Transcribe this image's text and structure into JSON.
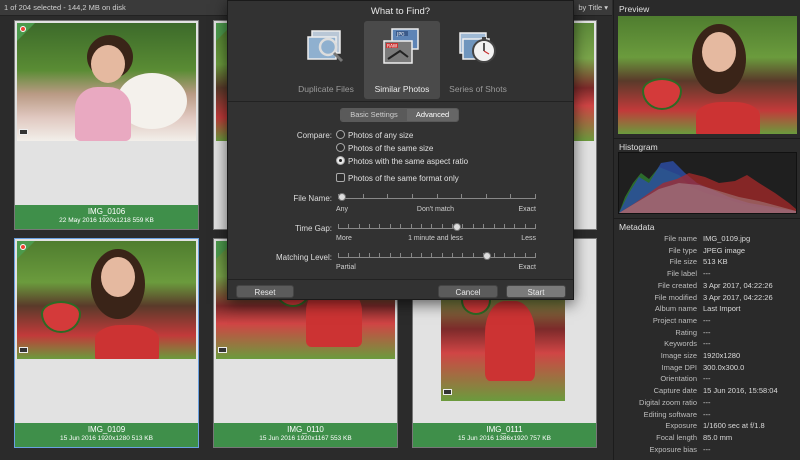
{
  "topbar": {
    "status": "1 of 204 selected - 144,2 MB on disk",
    "sort": "by Title ▾"
  },
  "cards": [
    {
      "name": "IMG_0106",
      "meta": "22 May 2016   1920x1218   559 KB"
    },
    {
      "name": "IMG_0109",
      "meta": "15 Jun 2016   1920x1280   513 KB"
    },
    {
      "name": "IMG_0110",
      "meta": "15 Jun 2016   1920x1167   553 KB"
    },
    {
      "name": "IMG_0111",
      "meta": "15 Jun 2016   1386x1920   757 KB"
    }
  ],
  "dialog": {
    "title": "What to Find?",
    "modes": [
      {
        "label": "Duplicate Files",
        "icon": "magnifier-photos-icon"
      },
      {
        "label": "Similar Photos",
        "icon": "jpg-raw-photos-icon"
      },
      {
        "label": "Series of Shots",
        "icon": "stopwatch-photos-icon"
      }
    ],
    "tabs": [
      "Basic Settings",
      "Advanced"
    ],
    "compare_label": "Compare:",
    "compare_options": [
      "Photos of any size",
      "Photos of the same size",
      "Photos with the same aspect ratio"
    ],
    "compare_selected": "Photos with the same aspect ratio",
    "same_format_label": "Photos of the same format only",
    "same_format_checked": false,
    "file_name": {
      "label": "File Name:",
      "min": "Any",
      "mid": "Don't match",
      "max": "Exact",
      "value": 0.0
    },
    "time_gap": {
      "label": "Time Gap:",
      "min": "More",
      "mid": "1 minute and less",
      "max": "Less",
      "value": 0.6
    },
    "matching": {
      "label": "Matching Level:",
      "min": "Partial",
      "max": "Exact",
      "value": 0.75
    },
    "buttons": {
      "reset": "Reset",
      "cancel": "Cancel",
      "start": "Start"
    }
  },
  "panel": {
    "preview_title": "Preview",
    "histogram_title": "Histogram",
    "metadata_title": "Metadata",
    "metadata": [
      {
        "k": "File name",
        "v": "IMG_0109.jpg"
      },
      {
        "k": "File type",
        "v": "JPEG image"
      },
      {
        "k": "File size",
        "v": "513 KB"
      },
      {
        "k": "File label",
        "v": "---"
      },
      {
        "k": "File created",
        "v": "3 Apr 2017, 04:22:26"
      },
      {
        "k": "File modified",
        "v": "3 Apr 2017, 04:22:26"
      },
      {
        "k": "Album name",
        "v": "Last Import"
      },
      {
        "k": "Project name",
        "v": "---"
      },
      {
        "k": "Rating",
        "v": "---"
      },
      {
        "k": "Keywords",
        "v": "---"
      },
      {
        "k": "Image size",
        "v": "1920x1280"
      },
      {
        "k": "Image DPI",
        "v": "300.0x300.0"
      },
      {
        "k": "Orientation",
        "v": "---"
      },
      {
        "k": "Capture date",
        "v": "15 Jun 2016, 15:58:04"
      },
      {
        "k": "Digital zoom ratio",
        "v": "---"
      },
      {
        "k": "Editing software",
        "v": "---"
      },
      {
        "k": "Exposure",
        "v": "1/1600 sec at f/1.8"
      },
      {
        "k": "Focal length",
        "v": "85.0 mm"
      },
      {
        "k": "Exposure bias",
        "v": "---"
      }
    ]
  }
}
